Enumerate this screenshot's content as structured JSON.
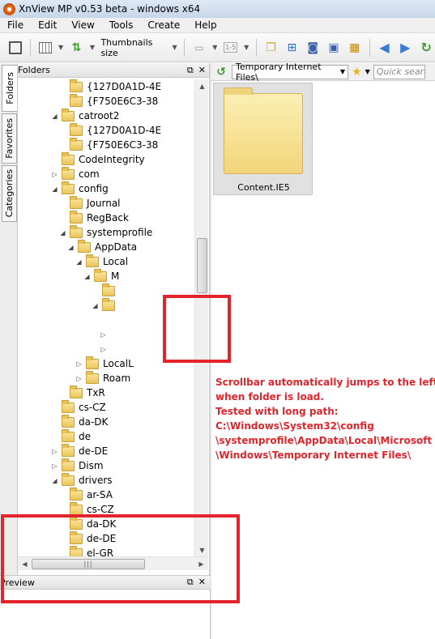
{
  "window": {
    "title": "XnView MP v0.53 beta - windows x64"
  },
  "menu": [
    "File",
    "Edit",
    "View",
    "Tools",
    "Create",
    "Help"
  ],
  "toolbar": {
    "thumbnails_size": "Thumbnails size"
  },
  "side_tabs": [
    "Folders",
    "Favorites",
    "Categories"
  ],
  "folders_panel": {
    "title": "Folders"
  },
  "tree": [
    {
      "label": "{127D0A1D-4E",
      "level": 6,
      "arrow": ""
    },
    {
      "label": "{F750E6C3-38",
      "level": 6,
      "arrow": ""
    },
    {
      "label": "catroot2",
      "level": 5,
      "arrow": "expanded"
    },
    {
      "label": "{127D0A1D-4E",
      "level": 6,
      "arrow": ""
    },
    {
      "label": "{F750E6C3-38",
      "level": 6,
      "arrow": ""
    },
    {
      "label": "CodeIntegrity",
      "level": 5,
      "arrow": ""
    },
    {
      "label": "com",
      "level": 5,
      "arrow": "collapsed"
    },
    {
      "label": "config",
      "level": 5,
      "arrow": "expanded"
    },
    {
      "label": "Journal",
      "level": 6,
      "arrow": ""
    },
    {
      "label": "RegBack",
      "level": 6,
      "arrow": ""
    },
    {
      "label": "systemprofile",
      "level": 6,
      "arrow": "expanded"
    },
    {
      "label": "AppData",
      "level": 7,
      "arrow": "expanded"
    },
    {
      "label": "Local",
      "level": 8,
      "arrow": "expanded"
    },
    {
      "label": "M",
      "level": 9,
      "arrow": "expanded"
    },
    {
      "label": "",
      "level": 10,
      "arrow": ""
    },
    {
      "label": "",
      "level": 10,
      "arrow": "expanded"
    },
    {
      "label": "",
      "level": 11,
      "arrow": "none"
    },
    {
      "label": "",
      "level": 11,
      "arrow": "collapsed-only"
    },
    {
      "label": "",
      "level": 11,
      "arrow": "collapsed-only"
    },
    {
      "label": "LocalL",
      "level": 8,
      "arrow": "collapsed"
    },
    {
      "label": "Roam",
      "level": 8,
      "arrow": "collapsed"
    },
    {
      "label": "TxR",
      "level": 6,
      "arrow": ""
    },
    {
      "label": "cs-CZ",
      "level": 5,
      "arrow": ""
    },
    {
      "label": "da-DK",
      "level": 5,
      "arrow": ""
    },
    {
      "label": "de",
      "level": 5,
      "arrow": ""
    },
    {
      "label": "de-DE",
      "level": 5,
      "arrow": "collapsed"
    },
    {
      "label": "Dism",
      "level": 5,
      "arrow": "collapsed"
    },
    {
      "label": "drivers",
      "level": 5,
      "arrow": "expanded"
    },
    {
      "label": "ar-SA",
      "level": 6,
      "arrow": ""
    },
    {
      "label": "cs-CZ",
      "level": 6,
      "arrow": ""
    },
    {
      "label": "da-DK",
      "level": 6,
      "arrow": ""
    },
    {
      "label": "de-DE",
      "level": 6,
      "arrow": ""
    },
    {
      "label": "el-GR",
      "level": 6,
      "arrow": ""
    }
  ],
  "preview_panel": {
    "title": "Preview"
  },
  "address_bar": {
    "path": "Temporary Internet Files\\",
    "search_placeholder": "Quick search"
  },
  "browser": {
    "items": [
      {
        "label": "Content.IE5"
      }
    ]
  },
  "annotation": [
    "Scrollbar automatically jumps to the left",
    "when folder is load.",
    "Tested with long path:",
    "C:\\Windows\\System32\\config",
    "\\systemprofile\\AppData\\Local\\Microsoft",
    "\\Windows\\Temporary Internet Files\\"
  ],
  "colors": {
    "annotation_red": "#e3242b",
    "folder_yellow": "#f1d57a"
  }
}
